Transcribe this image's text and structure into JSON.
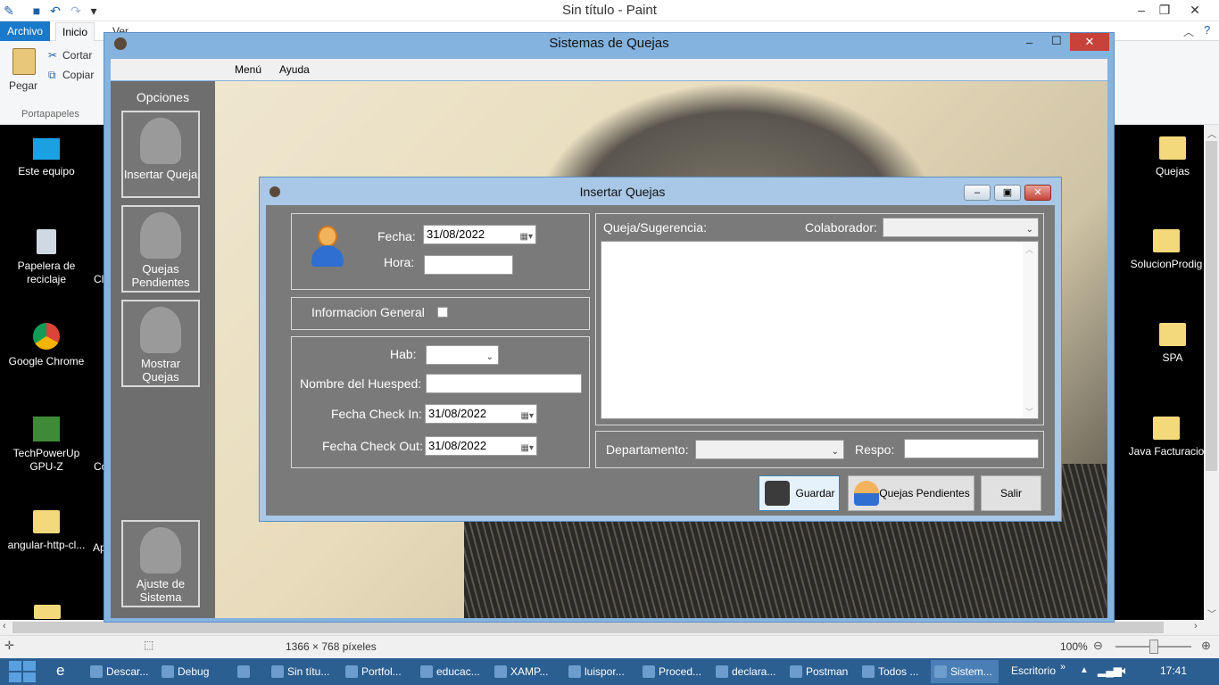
{
  "paint": {
    "title": "Sin título - Paint",
    "tabs": {
      "archivo": "Archivo",
      "inicio": "Inicio",
      "ver": "Ver"
    },
    "clipboard": {
      "paste": "Pegar",
      "cut": "Cortar",
      "copy": "Copiar",
      "group": "Portapapeles"
    },
    "status": {
      "dimensions": "1366 × 768 píxeles",
      "zoom": "100%"
    },
    "icons": [
      "save-icon",
      "undo-icon",
      "redo-icon",
      "dropdown-icon",
      "minimize-icon",
      "maximize-icon",
      "close-icon"
    ]
  },
  "desktop": {
    "left_icons": [
      {
        "label": "Este equipo",
        "icon": "computer-icon"
      },
      {
        "label": "Papelera de reciclaje",
        "icon": "recycle-bin-icon"
      },
      {
        "label": "Google Chrome",
        "icon": "chrome-icon"
      },
      {
        "label": "TechPowerUp GPU-Z",
        "icon": "gpuz-icon"
      },
      {
        "label": "angular-http-cl...",
        "icon": "folder-icon"
      }
    ],
    "partial_labels": [
      "Cl",
      "Co",
      "Ap"
    ],
    "right_icons": [
      {
        "label": "Quejas",
        "icon": "folder-icon"
      },
      {
        "label": "SolucionProdig",
        "icon": "folder-icon"
      },
      {
        "label": "SPA",
        "icon": "folder-icon"
      },
      {
        "label": "Java Facturacio",
        "icon": "folder-icon"
      }
    ]
  },
  "app": {
    "title": "Sistemas de Quejas",
    "menu": [
      "Menú",
      "Ayuda"
    ],
    "sidebar": {
      "title": "Opciones",
      "buttons": [
        "Insertar Queja",
        "Quejas Pendientes",
        "Mostrar Quejas",
        "Ajuste de Sistema"
      ]
    }
  },
  "dialog": {
    "title": "Insertar Quejas",
    "fecha_label": "Fecha:",
    "fecha_value": "31/08/2022",
    "hora_label": "Hora:",
    "hora_value": "",
    "info_general_label": "Informacion General",
    "hab_label": "Hab:",
    "hab_value": "",
    "huesped_label": "Nombre del Huesped:",
    "huesped_value": "",
    "checkin_label": "Fecha Check In:",
    "checkin_value": "31/08/2022",
    "checkout_label": "Fecha Check Out:",
    "checkout_value": "31/08/2022",
    "queja_label": "Queja/Sugerencia:",
    "queja_value": "",
    "colaborador_label": "Colaborador:",
    "colaborador_value": "",
    "departamento_label": "Departamento:",
    "departamento_value": "",
    "respo_label": "Respo:",
    "respo_value": "",
    "buttons": {
      "guardar": "Guardar",
      "pendientes": "Quejas Pendientes",
      "salir": "Salir"
    }
  },
  "taskbar": {
    "items": [
      "Descar...",
      "Debug",
      "",
      "Sin títu...",
      "Portfol...",
      "educac...",
      "XAMP...",
      "luispor...",
      "Proced...",
      "declara...",
      "Postman",
      "Todos ...",
      "Sistem..."
    ],
    "desktop_label": "Escritorio",
    "clock": "17:41"
  },
  "colors": {
    "ribbon_accent": "#1979ca",
    "taskbar": "#2b5e91",
    "dialog_body": "#7a7a7a",
    "sidebar": "#6e6e6e"
  }
}
